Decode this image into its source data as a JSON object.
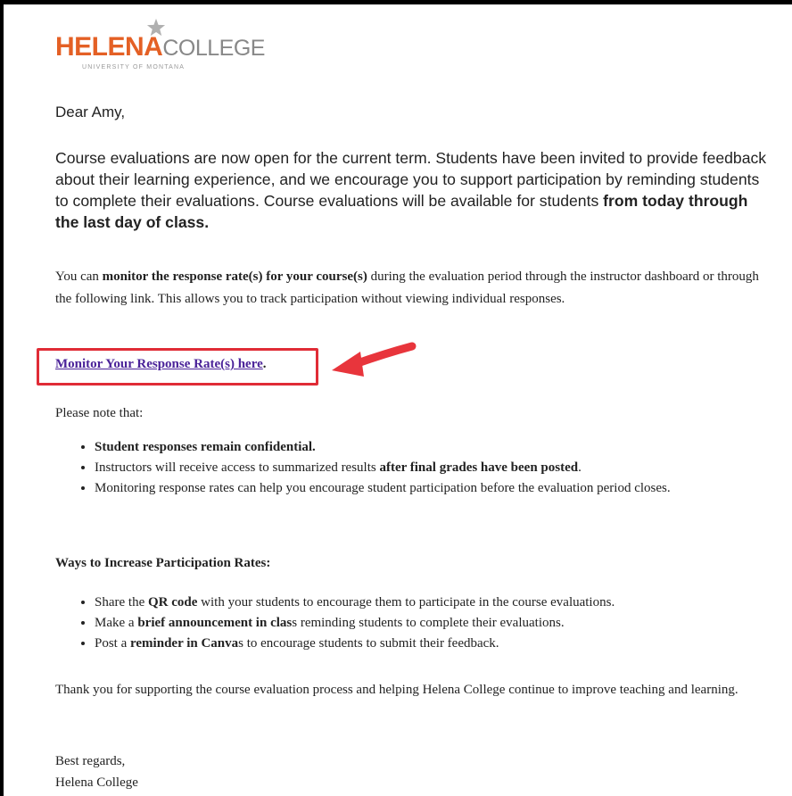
{
  "logo": {
    "name_bold": "HELENA",
    "name_light": "COLLEGE",
    "subtitle": "UNIVERSITY OF MONTANA",
    "star_icon": "star-icon",
    "brand_color": "#e46025"
  },
  "email": {
    "greeting": "Dear Amy,",
    "intro_text": "Course evaluations are now open for the current term. Students have been invited to provide feedback about their learning experience, and we encourage you to support participation by reminding students to complete their evaluations. Course evaluations will be available for students ",
    "intro_bold": "from today through the last day of class.",
    "monitor_pre": "You can ",
    "monitor_bold": "monitor the response rate(s) for your course(s)",
    "monitor_post": " during the evaluation period through the instructor dashboard or through the following link. This allows you to track participation without viewing individual responses.",
    "link_text": "Monitor Your Response Rate(s) here",
    "link_period": ".",
    "note_intro": "Please note that:",
    "notes": [
      {
        "pre": "",
        "bold": "Student responses remain confidential.",
        "post": ""
      },
      {
        "pre": "Instructors will receive access to summarized results ",
        "bold": "after final grades have been posted",
        "post": "."
      },
      {
        "pre": "Monitoring response rates can help you encourage student participation before the evaluation period closes.",
        "bold": "",
        "post": ""
      }
    ],
    "ways_heading": "Ways to Increase Participation Rates:",
    "ways": [
      {
        "pre": "Share the ",
        "bold": "QR code",
        "post": " with your students to encourage them to participate in the course evaluations."
      },
      {
        "pre": "Make a ",
        "bold": "brief announcement in clas",
        "post": "s reminding students to complete their evaluations."
      },
      {
        "pre": "Post a ",
        "bold": "reminder in Canva",
        "post": "s to encourage students to submit their feedback."
      }
    ],
    "thanks": "Thank you for supporting the course evaluation process and helping Helena College continue to improve teaching and learning.",
    "closing": "Best regards,",
    "signature": "Helena College"
  },
  "annotation": {
    "box_color": "#e02c36",
    "arrow_icon": "red-arrow-icon"
  }
}
